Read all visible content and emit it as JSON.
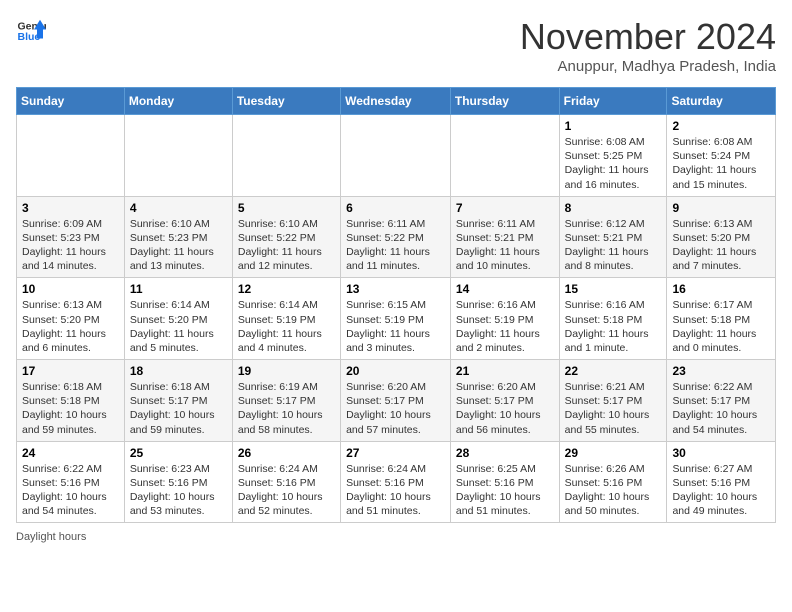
{
  "header": {
    "logo_line1": "General",
    "logo_line2": "Blue",
    "month_title": "November 2024",
    "location": "Anuppur, Madhya Pradesh, India"
  },
  "weekdays": [
    "Sunday",
    "Monday",
    "Tuesday",
    "Wednesday",
    "Thursday",
    "Friday",
    "Saturday"
  ],
  "weeks": [
    [
      {
        "day": "",
        "info": ""
      },
      {
        "day": "",
        "info": ""
      },
      {
        "day": "",
        "info": ""
      },
      {
        "day": "",
        "info": ""
      },
      {
        "day": "",
        "info": ""
      },
      {
        "day": "1",
        "info": "Sunrise: 6:08 AM\nSunset: 5:25 PM\nDaylight: 11 hours and 16 minutes."
      },
      {
        "day": "2",
        "info": "Sunrise: 6:08 AM\nSunset: 5:24 PM\nDaylight: 11 hours and 15 minutes."
      }
    ],
    [
      {
        "day": "3",
        "info": "Sunrise: 6:09 AM\nSunset: 5:23 PM\nDaylight: 11 hours and 14 minutes."
      },
      {
        "day": "4",
        "info": "Sunrise: 6:10 AM\nSunset: 5:23 PM\nDaylight: 11 hours and 13 minutes."
      },
      {
        "day": "5",
        "info": "Sunrise: 6:10 AM\nSunset: 5:22 PM\nDaylight: 11 hours and 12 minutes."
      },
      {
        "day": "6",
        "info": "Sunrise: 6:11 AM\nSunset: 5:22 PM\nDaylight: 11 hours and 11 minutes."
      },
      {
        "day": "7",
        "info": "Sunrise: 6:11 AM\nSunset: 5:21 PM\nDaylight: 11 hours and 10 minutes."
      },
      {
        "day": "8",
        "info": "Sunrise: 6:12 AM\nSunset: 5:21 PM\nDaylight: 11 hours and 8 minutes."
      },
      {
        "day": "9",
        "info": "Sunrise: 6:13 AM\nSunset: 5:20 PM\nDaylight: 11 hours and 7 minutes."
      }
    ],
    [
      {
        "day": "10",
        "info": "Sunrise: 6:13 AM\nSunset: 5:20 PM\nDaylight: 11 hours and 6 minutes."
      },
      {
        "day": "11",
        "info": "Sunrise: 6:14 AM\nSunset: 5:20 PM\nDaylight: 11 hours and 5 minutes."
      },
      {
        "day": "12",
        "info": "Sunrise: 6:14 AM\nSunset: 5:19 PM\nDaylight: 11 hours and 4 minutes."
      },
      {
        "day": "13",
        "info": "Sunrise: 6:15 AM\nSunset: 5:19 PM\nDaylight: 11 hours and 3 minutes."
      },
      {
        "day": "14",
        "info": "Sunrise: 6:16 AM\nSunset: 5:19 PM\nDaylight: 11 hours and 2 minutes."
      },
      {
        "day": "15",
        "info": "Sunrise: 6:16 AM\nSunset: 5:18 PM\nDaylight: 11 hours and 1 minute."
      },
      {
        "day": "16",
        "info": "Sunrise: 6:17 AM\nSunset: 5:18 PM\nDaylight: 11 hours and 0 minutes."
      }
    ],
    [
      {
        "day": "17",
        "info": "Sunrise: 6:18 AM\nSunset: 5:18 PM\nDaylight: 10 hours and 59 minutes."
      },
      {
        "day": "18",
        "info": "Sunrise: 6:18 AM\nSunset: 5:17 PM\nDaylight: 10 hours and 59 minutes."
      },
      {
        "day": "19",
        "info": "Sunrise: 6:19 AM\nSunset: 5:17 PM\nDaylight: 10 hours and 58 minutes."
      },
      {
        "day": "20",
        "info": "Sunrise: 6:20 AM\nSunset: 5:17 PM\nDaylight: 10 hours and 57 minutes."
      },
      {
        "day": "21",
        "info": "Sunrise: 6:20 AM\nSunset: 5:17 PM\nDaylight: 10 hours and 56 minutes."
      },
      {
        "day": "22",
        "info": "Sunrise: 6:21 AM\nSunset: 5:17 PM\nDaylight: 10 hours and 55 minutes."
      },
      {
        "day": "23",
        "info": "Sunrise: 6:22 AM\nSunset: 5:17 PM\nDaylight: 10 hours and 54 minutes."
      }
    ],
    [
      {
        "day": "24",
        "info": "Sunrise: 6:22 AM\nSunset: 5:16 PM\nDaylight: 10 hours and 54 minutes."
      },
      {
        "day": "25",
        "info": "Sunrise: 6:23 AM\nSunset: 5:16 PM\nDaylight: 10 hours and 53 minutes."
      },
      {
        "day": "26",
        "info": "Sunrise: 6:24 AM\nSunset: 5:16 PM\nDaylight: 10 hours and 52 minutes."
      },
      {
        "day": "27",
        "info": "Sunrise: 6:24 AM\nSunset: 5:16 PM\nDaylight: 10 hours and 51 minutes."
      },
      {
        "day": "28",
        "info": "Sunrise: 6:25 AM\nSunset: 5:16 PM\nDaylight: 10 hours and 51 minutes."
      },
      {
        "day": "29",
        "info": "Sunrise: 6:26 AM\nSunset: 5:16 PM\nDaylight: 10 hours and 50 minutes."
      },
      {
        "day": "30",
        "info": "Sunrise: 6:27 AM\nSunset: 5:16 PM\nDaylight: 10 hours and 49 minutes."
      }
    ]
  ],
  "footer": {
    "note": "Daylight hours"
  }
}
